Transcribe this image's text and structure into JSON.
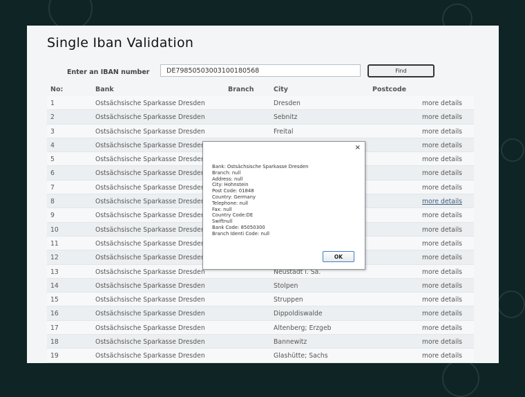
{
  "page": {
    "title": "Single Iban Validation"
  },
  "search": {
    "label": "Enter an IBAN number",
    "value": "DE79850503003100180568",
    "find_label": "Find"
  },
  "table": {
    "headers": {
      "no": "No:",
      "bank": "Bank",
      "branch": "Branch",
      "city": "City",
      "postcode": "Postcode"
    },
    "more_label": "more details",
    "rows": [
      {
        "no": "1",
        "bank": "Ostsächsische Sparkasse Dresden",
        "city": "Dresden"
      },
      {
        "no": "2",
        "bank": "Ostsächsische Sparkasse Dresden",
        "city": "Sebnitz"
      },
      {
        "no": "3",
        "bank": "Ostsächsische Sparkasse Dresden",
        "city": "Freital"
      },
      {
        "no": "4",
        "bank": "Ostsächsische Sparkasse Dresden",
        "city": ""
      },
      {
        "no": "5",
        "bank": "Ostsächsische Sparkasse Dresden",
        "city": ""
      },
      {
        "no": "6",
        "bank": "Ostsächsische Sparkasse Dresden",
        "city": ""
      },
      {
        "no": "7",
        "bank": "Ostsächsische Sparkasse Dresden",
        "city": ""
      },
      {
        "no": "8",
        "bank": "Ostsächsische Sparkasse Dresden",
        "city": ""
      },
      {
        "no": "9",
        "bank": "Ostsächsische Sparkasse Dresden",
        "city": ""
      },
      {
        "no": "10",
        "bank": "Ostsächsische Sparkasse Dresden",
        "city": ""
      },
      {
        "no": "11",
        "bank": "Ostsächsische Sparkasse Dresden",
        "city": ""
      },
      {
        "no": "12",
        "bank": "Ostsächsische Sparkasse Dresden",
        "city": ""
      },
      {
        "no": "13",
        "bank": "Ostsächsische Sparkasse Dresden",
        "city": "Neustadt i. Sa."
      },
      {
        "no": "14",
        "bank": "Ostsächsische Sparkasse Dresden",
        "city": "Stolpen"
      },
      {
        "no": "15",
        "bank": "Ostsächsische Sparkasse Dresden",
        "city": "Struppen"
      },
      {
        "no": "16",
        "bank": "Ostsächsische Sparkasse Dresden",
        "city": "Dippoldiswalde"
      },
      {
        "no": "17",
        "bank": "Ostsächsische Sparkasse Dresden",
        "city": "Altenberg; Erzgeb"
      },
      {
        "no": "18",
        "bank": "Ostsächsische Sparkasse Dresden",
        "city": "Bannewitz"
      },
      {
        "no": "19",
        "bank": "Ostsächsische Sparkasse Dresden",
        "city": "Glashütte; Sachs"
      }
    ]
  },
  "dialog": {
    "close": "×",
    "lines": [
      "Bank: Ostsächsische Sparkasse Dresden",
      "Branch: null",
      "Address: null",
      "City: Hohnstein",
      "Post Code: 01848",
      "Country: Germany",
      "Telephone: null",
      "Fax: null",
      "Country Code:DE",
      "Swiftnull",
      "Bank Code: 85050300",
      "Branch Identi Code: null"
    ],
    "ok_label": "OK"
  },
  "colors": {
    "background": "#0f2424",
    "panel": "#f3f5f6",
    "ok_border": "#3a7fc8"
  }
}
